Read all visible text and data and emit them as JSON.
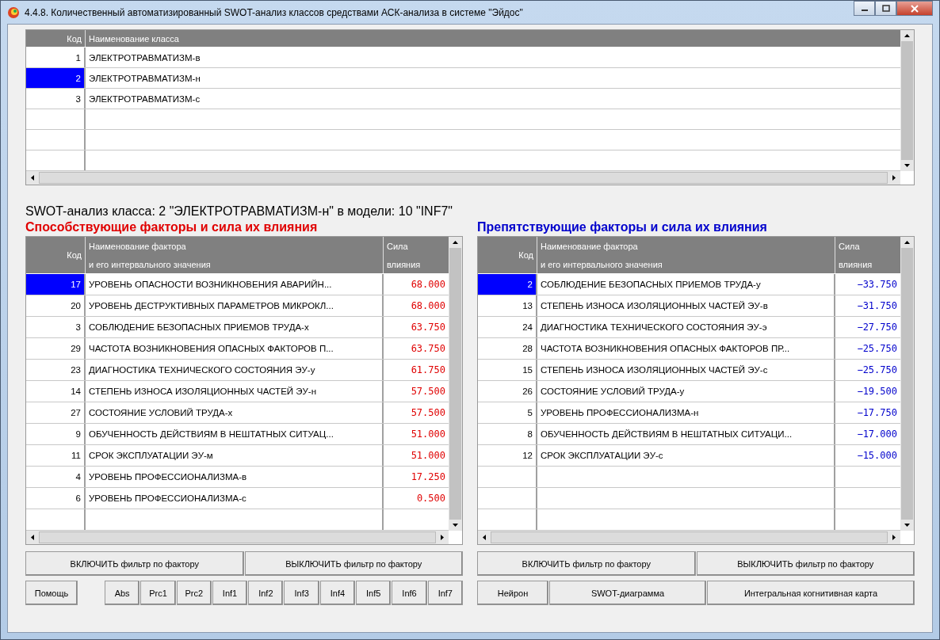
{
  "window": {
    "title": "4.4.8. Количественный автоматизированный SWOT-анализ классов средствами АСК-анализа в системе \"Эйдос\""
  },
  "classes_table": {
    "columns": [
      "Код",
      "Наименование класса"
    ],
    "rows": [
      {
        "code": "1",
        "name": "ЭЛЕКТРОТРАВМАТИЗМ-в",
        "selected": false
      },
      {
        "code": "2",
        "name": "ЭЛЕКТРОТРАВМАТИЗМ-н",
        "selected": true
      },
      {
        "code": "3",
        "name": "ЭЛЕКТРОТРАВМАТИЗМ-с",
        "selected": false
      }
    ]
  },
  "heading": "SWOT-анализ класса: 2 \"ЭЛЕКТРОТРАВМАТИЗМ-н\" в модели: 10 \"INF7\"",
  "panels": [
    {
      "title": "Способствующие факторы и сила их влияния",
      "color": "#e00000",
      "columns": [
        {
          "lines": [
            "Код"
          ]
        },
        {
          "lines": [
            "Наименование фактора",
            "и его интервального значения"
          ]
        },
        {
          "lines": [
            "Сила",
            "влияния"
          ]
        }
      ],
      "rows": [
        {
          "code": "17",
          "name": "УРОВЕНЬ ОПАСНОСТИ ВОЗНИКНОВЕНИЯ АВАРИЙН...",
          "value": "68.000",
          "selected": true
        },
        {
          "code": "20",
          "name": "УРОВЕНЬ ДЕСТРУКТИВНЫХ ПАРАМЕТРОВ МИКРОКЛ...",
          "value": "68.000",
          "selected": false
        },
        {
          "code": "3",
          "name": "СОБЛЮДЕНИЕ БЕЗОПАСНЫХ ПРИЕМОВ ТРУДА-х",
          "value": "63.750",
          "selected": false
        },
        {
          "code": "29",
          "name": "ЧАСТОТА ВОЗНИКНОВЕНИЯ ОПАСНЫХ ФАКТОРОВ П...",
          "value": "63.750",
          "selected": false
        },
        {
          "code": "23",
          "name": "ДИАГНОСТИКА ТЕХНИЧЕСКОГО СОСТОЯНИЯ ЭУ-у",
          "value": "61.750",
          "selected": false
        },
        {
          "code": "14",
          "name": "СТЕПЕНЬ ИЗНОСА ИЗОЛЯЦИОННЫХ ЧАСТЕЙ ЭУ-н",
          "value": "57.500",
          "selected": false
        },
        {
          "code": "27",
          "name": "СОСТОЯНИЕ УСЛОВИЙ ТРУДА-х",
          "value": "57.500",
          "selected": false
        },
        {
          "code": "9",
          "name": "ОБУЧЕННОСТЬ ДЕЙСТВИЯМ В НЕШТАТНЫХ СИТУАЦ...",
          "value": "51.000",
          "selected": false
        },
        {
          "code": "11",
          "name": "СРОК ЭКСПЛУАТАЦИИ ЭУ-м",
          "value": "51.000",
          "selected": false
        },
        {
          "code": "4",
          "name": "УРОВЕНЬ ПРОФЕССИОНАЛИЗМА-в",
          "value": "17.250",
          "selected": false
        },
        {
          "code": "6",
          "name": "УРОВЕНЬ ПРОФЕССИОНАЛИЗМА-с",
          "value": "0.500",
          "selected": false
        }
      ],
      "filter_buttons": [
        "ВКЛЮЧИТЬ фильтр по фактору",
        "ВЫКЛЮЧИТЬ фильтр по фактору"
      ]
    },
    {
      "title": "Препятствующие факторы и сила их влияния",
      "color": "#0000cc",
      "columns": [
        {
          "lines": [
            "Код"
          ]
        },
        {
          "lines": [
            "Наименование фактора",
            "и его интервального значения"
          ]
        },
        {
          "lines": [
            "Сила",
            "влияния"
          ]
        }
      ],
      "rows": [
        {
          "code": "2",
          "name": "СОБЛЮДЕНИЕ БЕЗОПАСНЫХ ПРИЕМОВ ТРУДА-у",
          "value": "−33.750",
          "selected": true
        },
        {
          "code": "13",
          "name": "СТЕПЕНЬ ИЗНОСА ИЗОЛЯЦИОННЫХ ЧАСТЕЙ ЭУ-в",
          "value": "−31.750",
          "selected": false
        },
        {
          "code": "24",
          "name": "ДИАГНОСТИКА ТЕХНИЧЕСКОГО СОСТОЯНИЯ ЭУ-э",
          "value": "−27.750",
          "selected": false
        },
        {
          "code": "28",
          "name": "ЧАСТОТА ВОЗНИКНОВЕНИЯ ОПАСНЫХ ФАКТОРОВ ПР...",
          "value": "−25.750",
          "selected": false
        },
        {
          "code": "15",
          "name": "СТЕПЕНЬ ИЗНОСА ИЗОЛЯЦИОННЫХ ЧАСТЕЙ ЭУ-с",
          "value": "−25.750",
          "selected": false
        },
        {
          "code": "26",
          "name": "СОСТОЯНИЕ УСЛОВИЙ ТРУДА-у",
          "value": "−19.500",
          "selected": false
        },
        {
          "code": "5",
          "name": "УРОВЕНЬ ПРОФЕССИОНАЛИЗМА-н",
          "value": "−17.750",
          "selected": false
        },
        {
          "code": "8",
          "name": "ОБУЧЕННОСТЬ ДЕЙСТВИЯМ В НЕШТАТНЫХ СИТУАЦИ...",
          "value": "−17.000",
          "selected": false
        },
        {
          "code": "12",
          "name": "СРОК ЭКСПЛУАТАЦИИ ЭУ-с",
          "value": "−15.000",
          "selected": false
        }
      ],
      "filter_buttons": [
        "ВКЛЮЧИТЬ фильтр по фактору",
        "ВЫКЛЮЧИТЬ фильтр по фактору"
      ]
    }
  ],
  "help_button": "Помощь",
  "model_buttons": [
    "Abs",
    "Prc1",
    "Prc2",
    "Inf1",
    "Inf2",
    "Inf3",
    "Inf4",
    "Inf5",
    "Inf6",
    "Inf7"
  ],
  "tool_buttons": [
    "Нейрон",
    "SWOT-диаграмма",
    "Интегральная когнитивная карта"
  ]
}
